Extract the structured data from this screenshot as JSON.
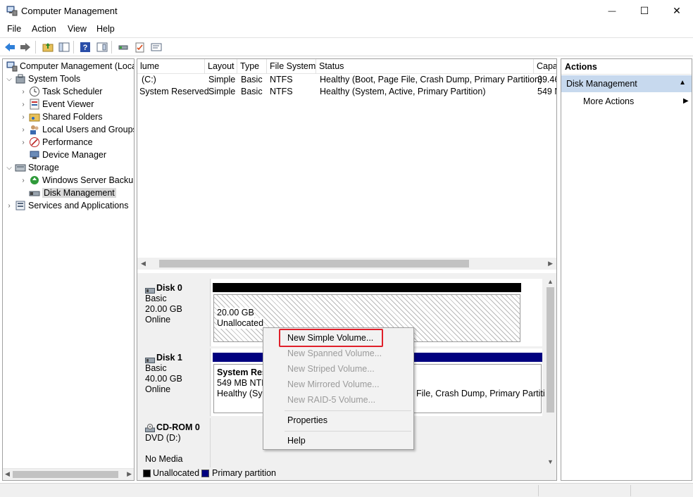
{
  "window": {
    "title": "Computer Management"
  },
  "window_buttons": {
    "minimize": "—",
    "maximize": "☐",
    "close": "✕"
  },
  "menu": [
    "File",
    "Action",
    "View",
    "Help"
  ],
  "toolbar_icons": [
    "back-arrow-icon",
    "forward-arrow-icon",
    "up-folder-icon",
    "show-hide-tree-icon",
    "help-icon",
    "console-view-icon",
    "disk-icon",
    "checklist-icon",
    "properties-icon"
  ],
  "tree": {
    "root": "Computer Management (Local",
    "items": [
      {
        "label": "System Tools",
        "chevron": "⌵"
      },
      {
        "label": "Task Scheduler",
        "chevron": "›"
      },
      {
        "label": "Event Viewer",
        "chevron": "›"
      },
      {
        "label": "Shared Folders",
        "chevron": "›"
      },
      {
        "label": "Local Users and Groups",
        "chevron": "›"
      },
      {
        "label": "Performance",
        "chevron": "›"
      },
      {
        "label": "Device Manager",
        "chevron": ""
      },
      {
        "label": "Storage",
        "chevron": "⌵"
      },
      {
        "label": "Windows Server Backup",
        "chevron": "›"
      },
      {
        "label": "Disk Management",
        "chevron": ""
      },
      {
        "label": "Services and Applications",
        "chevron": "›"
      }
    ]
  },
  "volume_list": {
    "columns": [
      "lume",
      "Layout",
      "Type",
      "File System",
      "Status",
      "Capa"
    ],
    "rows": [
      [
        "(C:)",
        "Simple",
        "Basic",
        "NTFS",
        "Healthy (Boot, Page File, Crash Dump, Primary Partition)",
        "39.46"
      ],
      [
        "System Reserved",
        "Simple",
        "Basic",
        "NTFS",
        "Healthy (System, Active, Primary Partition)",
        "549 M"
      ]
    ]
  },
  "disks": [
    {
      "name": "Disk 0",
      "type": "Basic",
      "size": "20.00 GB",
      "status": "Online"
    },
    {
      "name": "Disk 1",
      "type": "Basic",
      "size": "40.00 GB",
      "status": "Online"
    },
    {
      "name": "CD-ROM 0",
      "type": "DVD (D:)",
      "size": "",
      "status": "No Media"
    }
  ],
  "partitions": {
    "disk0_unallocated": {
      "size": "20.00 GB",
      "label": "Unallocated"
    },
    "disk1_system_reserved": {
      "name": "System Res",
      "size": "549 MB NTF",
      "status": "Healthy (Sys"
    },
    "disk1_c_status_tail": "File, Crash Dump, Primary Partiti"
  },
  "legend": [
    {
      "label": "Unallocated",
      "color": "#000000"
    },
    {
      "label": "Primary partition",
      "color": "#00007f"
    }
  ],
  "actions": {
    "header": "Actions",
    "section": "Disk Management",
    "more": "More Actions"
  },
  "context_menu": {
    "items": [
      {
        "label": "New Simple Volume...",
        "enabled": true
      },
      {
        "label": "New Spanned Volume...",
        "enabled": false
      },
      {
        "label": "New Striped Volume...",
        "enabled": false
      },
      {
        "label": "New Mirrored Volume...",
        "enabled": false
      },
      {
        "label": "New RAID-5 Volume...",
        "enabled": false
      },
      {
        "label": "Properties",
        "enabled": true
      },
      {
        "label": "Help",
        "enabled": true
      }
    ]
  },
  "colors": {
    "primary_partition_bar": "#00007f",
    "unallocated_bar": "#000000",
    "highlight_box": "#e0202a",
    "actions_section_bg": "#c7d9ee"
  }
}
